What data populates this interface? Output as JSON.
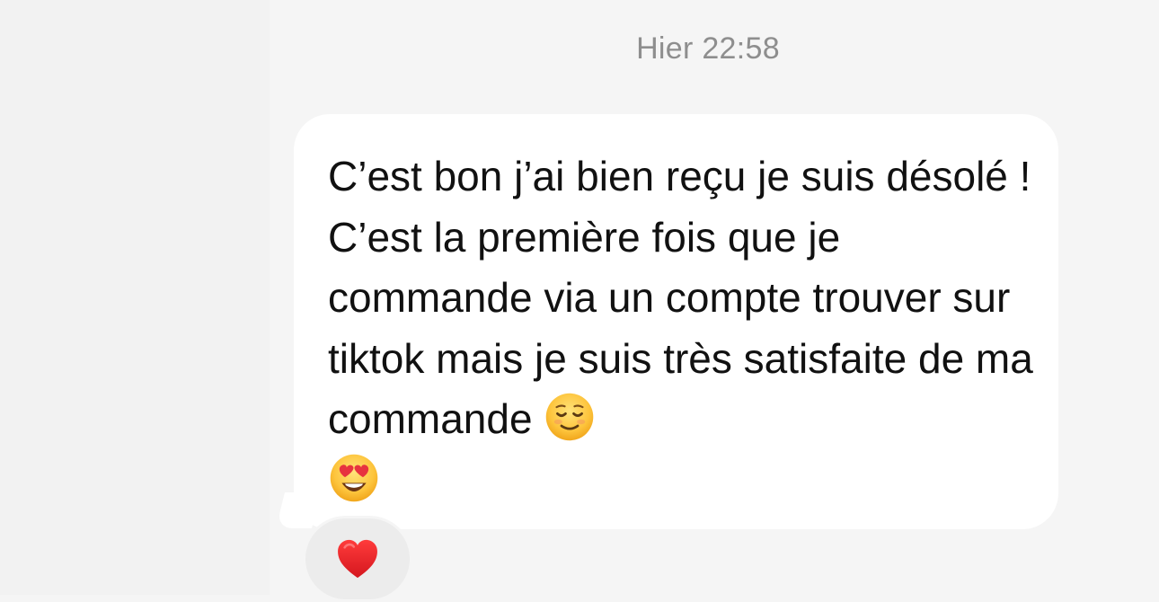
{
  "conversation": {
    "timestamp": "Hier 22:58",
    "message": {
      "text": "C’est bon j’ai bien reçu je suis désolé ! C’est la première fois que je commande via un compte trouver sur tiktok mais je suis très satisfaite de ma commande",
      "emojis": [
        "relieved-face-emoji",
        "heart-eyes-emoji"
      ],
      "bubble_color": "#ffffff",
      "text_color": "#111111"
    },
    "reaction": {
      "emoji": "red-heart-emoji",
      "background": "#ececec"
    }
  },
  "colors": {
    "background": "#f5f5f5",
    "timestamp": "#8e8e8e"
  }
}
